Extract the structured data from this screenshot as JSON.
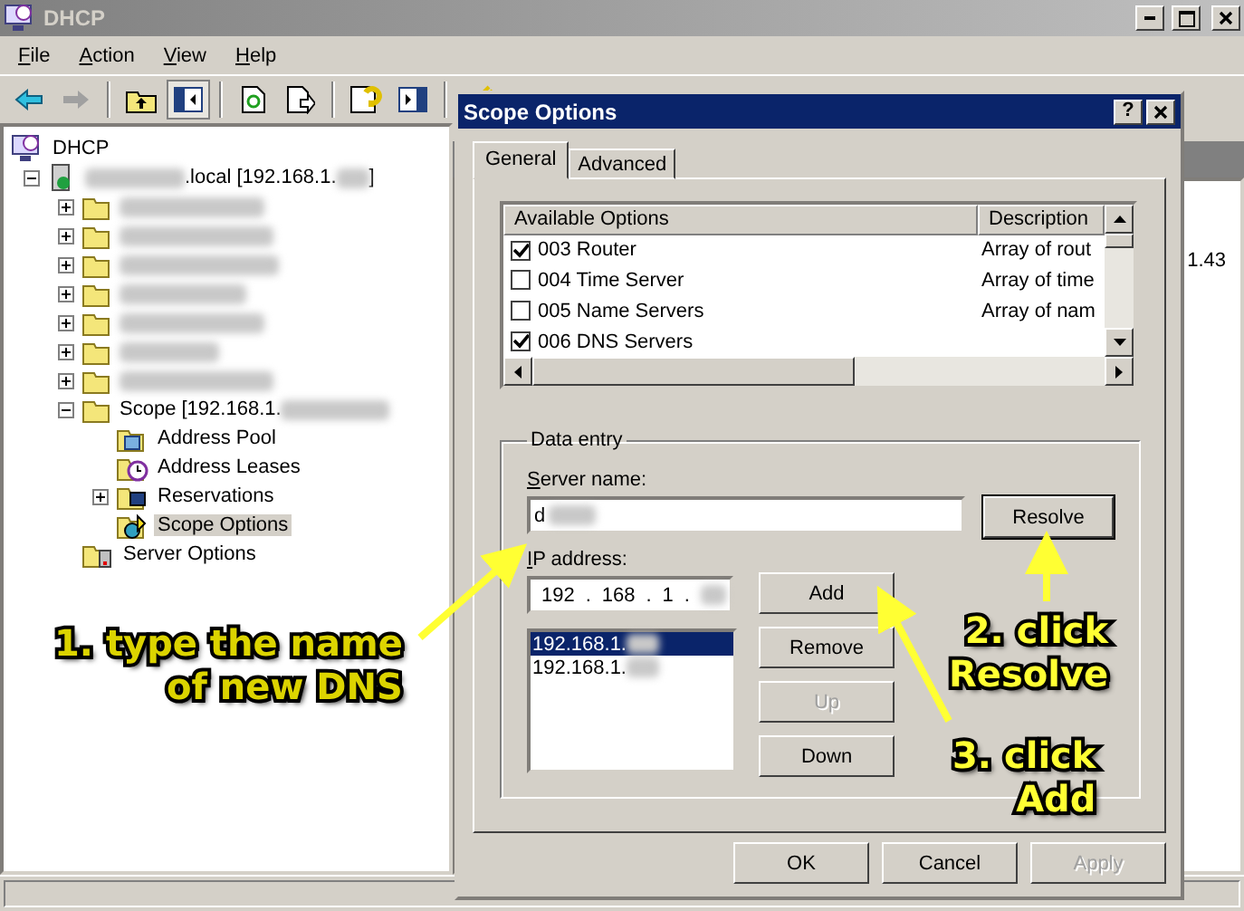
{
  "window": {
    "title": "DHCP"
  },
  "menu": [
    "File",
    "Action",
    "View",
    "Help"
  ],
  "tree": [
    {
      "kind": "root",
      "segments": [
        {
          "kind": "text",
          "text": "DHCP"
        }
      ],
      "selected": false,
      "children": [
        {
          "kind": "server",
          "segments": [
            {
              "kind": "blurred"
            },
            {
              "kind": "text",
              "text": ".local [192.168.1."
            },
            {
              "kind": "blurred"
            },
            {
              "kind": "text",
              "text": "]"
            }
          ],
          "selected": false,
          "expanded": true,
          "children": [
            {
              "kind": "folder",
              "segments": [
                {
                  "kind": "blurred"
                }
              ],
              "selected": false,
              "expanded": false
            },
            {
              "kind": "folder",
              "segments": [
                {
                  "kind": "blurred"
                }
              ],
              "selected": false,
              "expanded": false
            },
            {
              "kind": "folder",
              "segments": [
                {
                  "kind": "blurred"
                }
              ],
              "selected": false,
              "expanded": false
            },
            {
              "kind": "folder",
              "segments": [
                {
                  "kind": "blurred"
                }
              ],
              "selected": false,
              "expanded": false
            },
            {
              "kind": "folder",
              "segments": [
                {
                  "kind": "blurred"
                }
              ],
              "selected": false,
              "expanded": false
            },
            {
              "kind": "folder",
              "segments": [
                {
                  "kind": "blurred"
                }
              ],
              "selected": false,
              "expanded": false
            },
            {
              "kind": "folder",
              "segments": [
                {
                  "kind": "blurred"
                }
              ],
              "selected": false,
              "expanded": false
            },
            {
              "kind": "folder",
              "segments": [
                {
                  "kind": "text",
                  "text": "Scope [192.168.1."
                },
                {
                  "kind": "blurred"
                }
              ],
              "selected": false,
              "expanded": true,
              "children": [
                {
                  "kind": "pool",
                  "segments": [
                    {
                      "kind": "text",
                      "text": "Address Pool"
                    }
                  ],
                  "selected": false
                },
                {
                  "kind": "leases",
                  "segments": [
                    {
                      "kind": "text",
                      "text": "Address Leases"
                    }
                  ],
                  "selected": false
                },
                {
                  "kind": "reservations",
                  "segments": [
                    {
                      "kind": "text",
                      "text": "Reservations"
                    }
                  ],
                  "selected": false,
                  "expanded": false
                },
                {
                  "kind": "options",
                  "segments": [
                    {
                      "kind": "text",
                      "text": "Scope Options"
                    }
                  ],
                  "selected": true
                }
              ]
            },
            {
              "kind": "server-options",
              "segments": [
                {
                  "kind": "text",
                  "text": "Server Options"
                }
              ],
              "selected": false
            }
          ]
        }
      ]
    }
  ],
  "right_pane": {
    "cells": [
      "1.43"
    ]
  },
  "dialog": {
    "title": "Scope Options",
    "help": "?",
    "tabs": [
      {
        "label": "General",
        "selected": true
      },
      {
        "label": "Advanced",
        "selected": false
      }
    ],
    "options": {
      "columns": [
        "Available Options",
        "Description"
      ],
      "rows": [
        {
          "name": "003 Router",
          "description": "Array of rout",
          "checked": true
        },
        {
          "name": "004 Time Server",
          "description": "Array of time",
          "checked": false
        },
        {
          "name": "005 Name Servers",
          "description": "Array of nam",
          "checked": false
        },
        {
          "name": "006 DNS Servers",
          "checked": true
        }
      ]
    },
    "data_entry": {
      "legend": "Data entry",
      "server_name": {
        "label": "Server name:",
        "value": "d"
      },
      "resolve": "Resolve",
      "ip": {
        "label": "IP address:",
        "octets": [
          "192",
          "168",
          "1"
        ],
        "separator": "."
      },
      "addresses": [
        {
          "text": "192.168.1.",
          "selected": true
        },
        {
          "text": "192.168.1.",
          "selected": false
        }
      ],
      "buttons": [
        {
          "label": "Add",
          "disabled": false
        },
        {
          "label": "Remove",
          "disabled": false
        },
        {
          "label": "Up",
          "disabled": true
        },
        {
          "label": "Down",
          "disabled": false
        }
      ]
    },
    "footer": [
      {
        "label": "OK",
        "disabled": false
      },
      {
        "label": "Cancel",
        "disabled": false
      },
      {
        "label": "Apply",
        "disabled": true
      }
    ]
  },
  "callouts": [
    {
      "lines": [
        "1. type the name",
        "of new DNS"
      ]
    },
    {
      "lines": [
        "2. click",
        "Resolve"
      ]
    },
    {
      "lines": [
        "3. click",
        "Add"
      ]
    }
  ]
}
